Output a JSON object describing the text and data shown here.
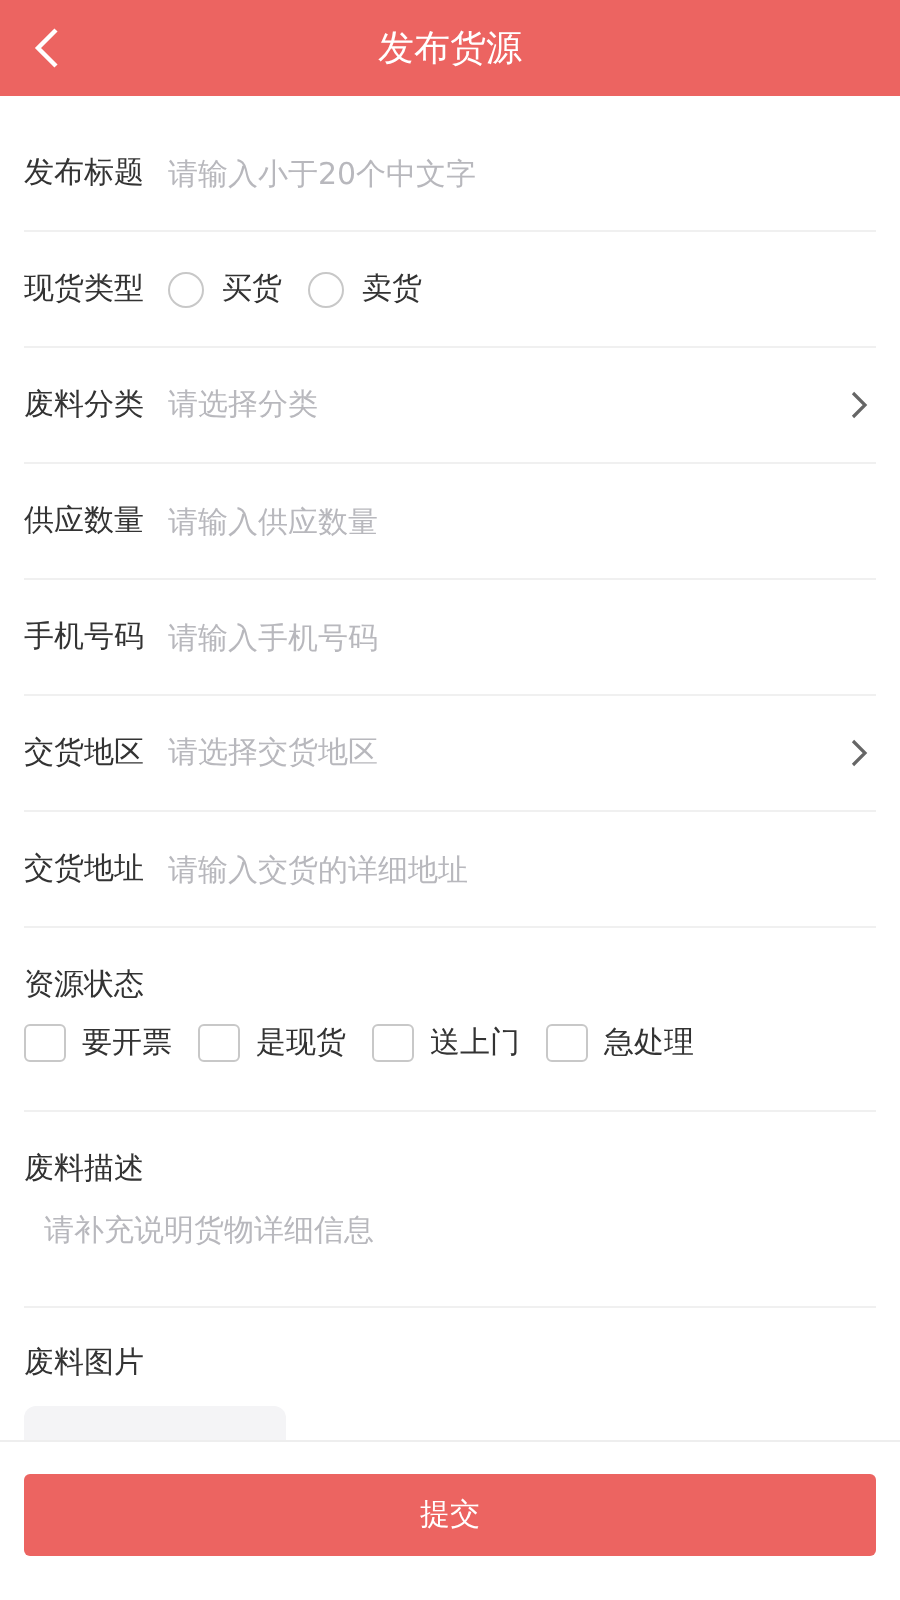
{
  "header": {
    "title": "发布货源"
  },
  "fields": [
    {
      "kind": "input",
      "label": "发布标题",
      "placeholder": "请输入小于20个中文字"
    },
    {
      "kind": "radio",
      "label": "现货类型",
      "options": [
        {
          "label": "买货",
          "selected": false
        },
        {
          "label": "卖货",
          "selected": false
        }
      ]
    },
    {
      "kind": "select",
      "label": "废料分类",
      "placeholder": "请选择分类"
    },
    {
      "kind": "input",
      "label": "供应数量",
      "placeholder": "请输入供应数量"
    },
    {
      "kind": "input",
      "label": "手机号码",
      "placeholder": "请输入手机号码"
    },
    {
      "kind": "select",
      "label": "交货地区",
      "placeholder": "请选择交货地区"
    },
    {
      "kind": "input",
      "label": "交货地址",
      "placeholder": "请输入交货的详细地址"
    }
  ],
  "status": {
    "label": "资源状态",
    "options": [
      {
        "label": "要开票",
        "checked": false
      },
      {
        "label": "是现货",
        "checked": false
      },
      {
        "label": "送上门",
        "checked": false
      },
      {
        "label": "急处理",
        "checked": false
      }
    ]
  },
  "description": {
    "label": "废料描述",
    "placeholder": "请补充说明货物详细信息"
  },
  "images": {
    "label": "废料图片"
  },
  "submit": {
    "label": "提交"
  }
}
